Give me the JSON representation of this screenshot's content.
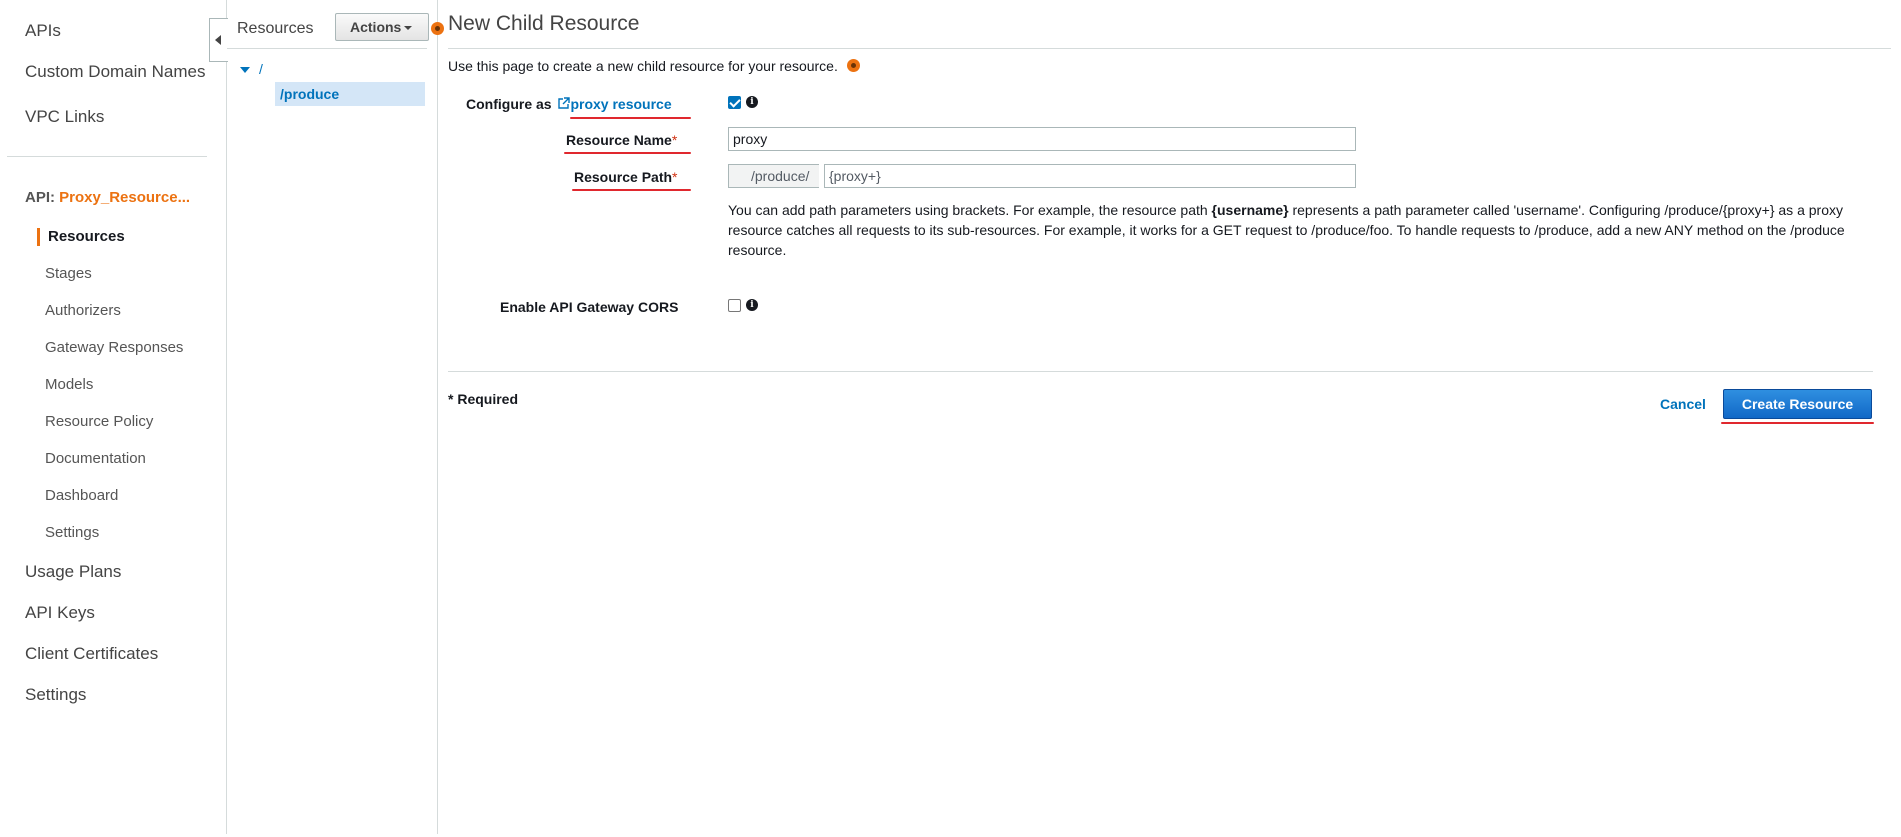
{
  "left_nav": {
    "top_items": [
      "APIs",
      "Custom Domain Names",
      "VPC Links"
    ],
    "api_prefix": "API:",
    "api_name": "Proxy_Resource...",
    "sub_items": [
      "Resources",
      "Stages",
      "Authorizers",
      "Gateway Responses",
      "Models",
      "Resource Policy",
      "Documentation",
      "Dashboard",
      "Settings"
    ],
    "active_sub_item": "Resources",
    "bottom_items": [
      "Usage Plans",
      "API Keys",
      "Client Certificates",
      "Settings"
    ]
  },
  "resources_panel": {
    "title": "Resources",
    "actions_label": "Actions",
    "tree_root": "/",
    "tree_child": "/produce"
  },
  "main": {
    "title": "New Child Resource",
    "intro": "Use this page to create a new child resource for your resource.",
    "configure_as_label": "Configure as",
    "proxy_resource_link": "proxy resource",
    "proxy_checked": true,
    "resource_name_label": "Resource Name",
    "resource_name_value": "proxy",
    "resource_path_label": "Resource Path",
    "resource_path_prefix": "/produce/",
    "resource_path_value": "{proxy+}",
    "help_text_1": "You can add path parameters using brackets. For example, the resource path ",
    "help_text_bold": "{username}",
    "help_text_2": " represents a path parameter called 'username'. Configuring /produce/{proxy+} as a proxy resource catches all requests to its sub-resources. For example, it works for a GET request to /produce/foo. To handle requests to /produce, add a new ANY method on the /produce resource.",
    "cors_label": "Enable API Gateway CORS",
    "cors_checked": false,
    "required_star": "*",
    "required_note": "* Required",
    "cancel_label": "Cancel",
    "create_label": "Create Resource",
    "info_glyph": "i"
  },
  "colors": {
    "accent_orange": "#ec7211",
    "link_blue": "#0073bb",
    "annotation_red": "#e0282e",
    "primary_button": "#1168c7"
  }
}
